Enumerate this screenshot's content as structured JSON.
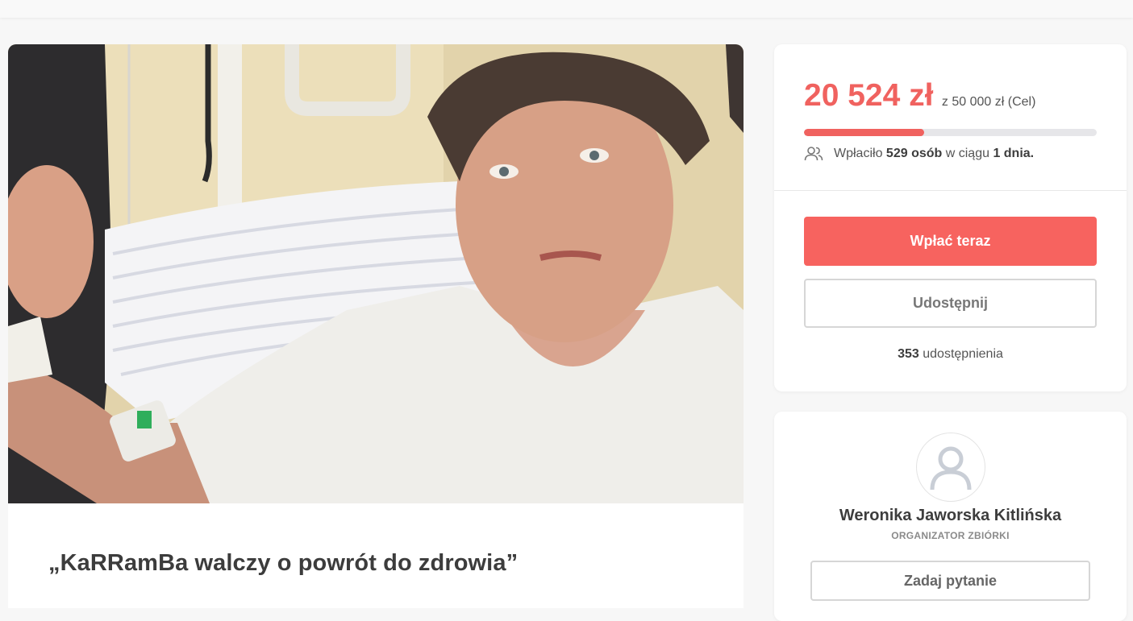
{
  "campaign": {
    "title": "„KaRRamBa walczy o powrót do zdrowia”"
  },
  "donation": {
    "amount": "20 524 zł",
    "goal": "z 50 000 zł (Cel)",
    "progress_fraction": 0.41,
    "donors_prefix": "Wpłaciło",
    "donors_count": "529 osób",
    "donors_middle": "w ciągu",
    "donors_period": "1 dnia.",
    "donate_button": "Wpłać teraz",
    "share_button": "Udostępnij",
    "shares_count": "353",
    "shares_label": "udostępnienia"
  },
  "organizer": {
    "name": "Weronika Jaworska Kitlińska",
    "role": "ORGANIZATOR ZBIÓRKI",
    "ask_button": "Zadaj pytanie"
  },
  "colors": {
    "accent": "#f7635f",
    "amount": "#f0625f"
  },
  "icons": {
    "donors": "users-icon",
    "avatar": "user-avatar-icon"
  }
}
